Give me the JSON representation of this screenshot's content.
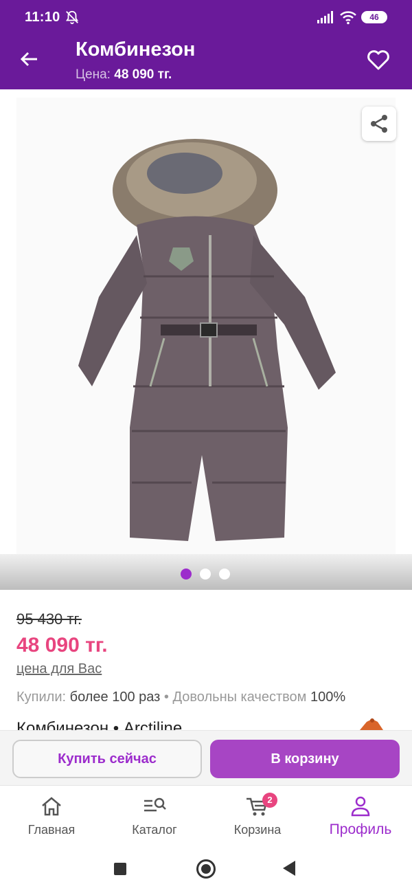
{
  "status_bar": {
    "time": "11:10",
    "battery": "46",
    "icons": [
      "mute-bell-icon",
      "signal-icon",
      "wifi-icon",
      "battery-icon"
    ]
  },
  "app_bar": {
    "title": "Комбинезон",
    "price_label": "Цена:",
    "price_value": "48 090 тг.",
    "icons": [
      "back-arrow-icon",
      "heart-icon"
    ]
  },
  "gallery": {
    "image_count": 3,
    "active_index": 0,
    "icons": [
      "share-icon"
    ]
  },
  "product": {
    "old_price": "95 430 тг.",
    "new_price": "48 090 тг.",
    "price_for_you": "цена для Вас",
    "bought_label": "Купили:",
    "bought_value": "более 100 раз",
    "separator": "•",
    "quality_label": "Довольны качеством",
    "quality_value": "100%",
    "name": "Комбинезон • Arctiline"
  },
  "actions": {
    "buy_now": "Купить сейчас",
    "add_to_cart": "В корзину"
  },
  "bottom_nav": {
    "items": [
      {
        "label": "Главная",
        "icon": "home-icon"
      },
      {
        "label": "Каталог",
        "icon": "catalog-search-icon"
      },
      {
        "label": "Корзина",
        "icon": "cart-icon",
        "badge": "2"
      },
      {
        "label": "Профиль",
        "icon": "profile-icon"
      }
    ],
    "active_index": 3
  },
  "colors": {
    "primary": "#6a1a9a",
    "accent": "#a745c4",
    "price": "#e8457f"
  }
}
